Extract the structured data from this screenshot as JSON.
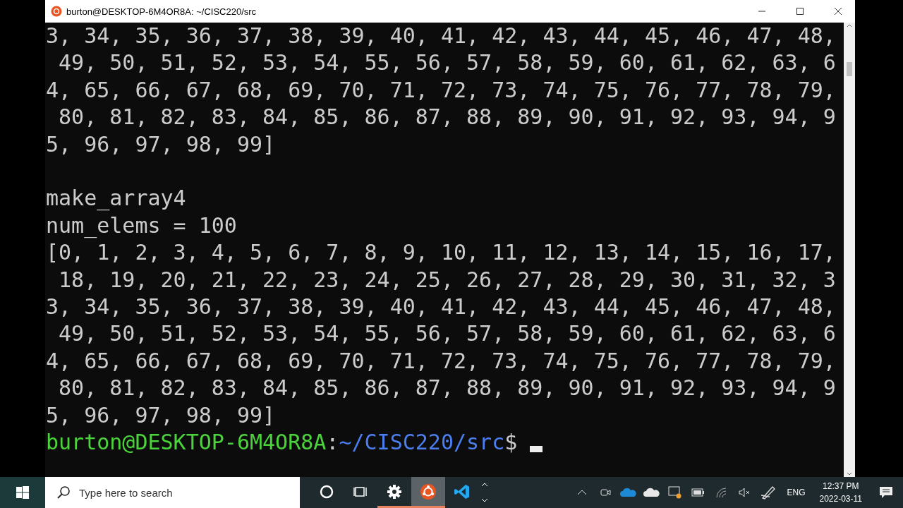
{
  "window": {
    "title": "burton@DESKTOP-6M4OR8A: ~/CISC220/src"
  },
  "terminal": {
    "blocks": [
      [
        "3, 34, 35, 36, 37, 38, 39, 40, 41, 42, 43, 44, 45, 46, 47, 48,",
        " 49, 50, 51, 52, 53, 54, 55, 56, 57, 58, 59, 60, 61, 62, 63, 6",
        "4, 65, 66, 67, 68, 69, 70, 71, 72, 73, 74, 75, 76, 77, 78, 79,",
        " 80, 81, 82, 83, 84, 85, 86, 87, 88, 89, 90, 91, 92, 93, 94, 9",
        "5, 96, 97, 98, 99]"
      ],
      [
        "make_array4",
        "num_elems = 100",
        "[0, 1, 2, 3, 4, 5, 6, 7, 8, 9, 10, 11, 12, 13, 14, 15, 16, 17,",
        " 18, 19, 20, 21, 22, 23, 24, 25, 26, 27, 28, 29, 30, 31, 32, 3",
        "3, 34, 35, 36, 37, 38, 39, 40, 41, 42, 43, 44, 45, 46, 47, 48,",
        " 49, 50, 51, 52, 53, 54, 55, 56, 57, 58, 59, 60, 61, 62, 63, 6",
        "4, 65, 66, 67, 68, 69, 70, 71, 72, 73, 74, 75, 76, 77, 78, 79,",
        " 80, 81, 82, 83, 84, 85, 86, 87, 88, 89, 90, 91, 92, 93, 94, 9",
        "5, 96, 97, 98, 99]"
      ]
    ],
    "prompt": {
      "user_host": "burton@DESKTOP-6M4OR8A",
      "separator": ":",
      "path": "~/CISC220/src",
      "symbol": "$"
    }
  },
  "taskbar": {
    "search": {
      "placeholder": "Type here to search"
    },
    "apps": [
      {
        "kind": "cortana",
        "running": false,
        "selected": false
      },
      {
        "kind": "taskview",
        "running": false,
        "selected": false
      },
      {
        "kind": "settings",
        "running": true,
        "selected": false
      },
      {
        "kind": "ubuntu",
        "running": true,
        "selected": true
      },
      {
        "kind": "vscode",
        "running": false,
        "selected": false
      }
    ],
    "language": "ENG",
    "time": "12:37 PM",
    "date": "2022-03-11"
  }
}
